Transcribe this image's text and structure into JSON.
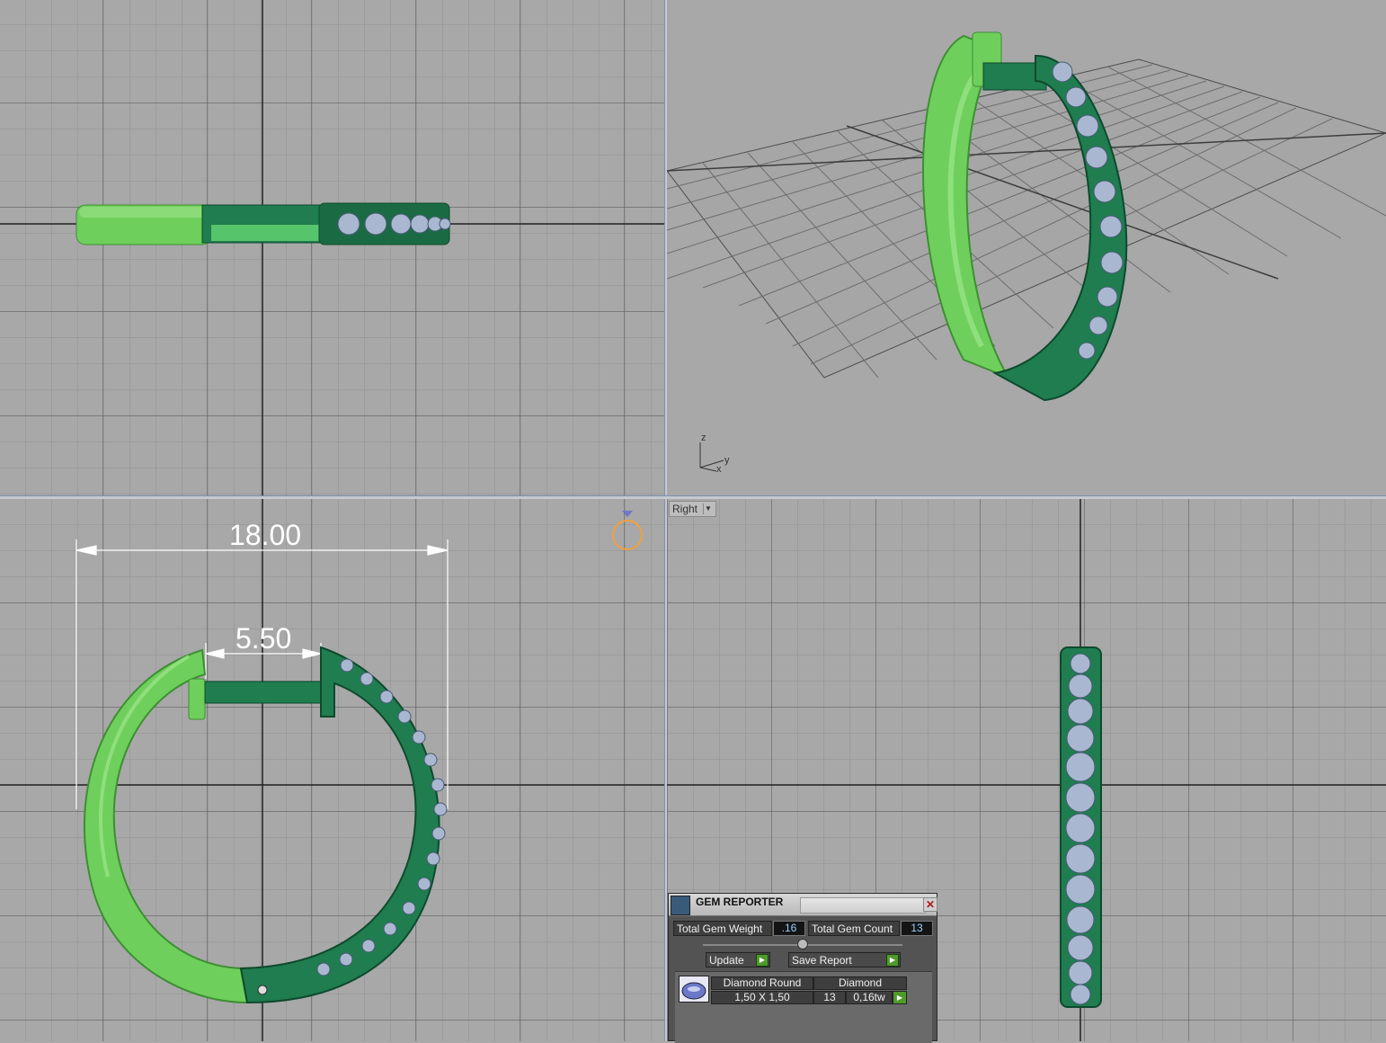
{
  "viewports": {
    "right_label": "Right",
    "front": {
      "dim_overall": "18.00",
      "dim_opening": "5.50"
    },
    "axis": {
      "z": "z",
      "y": "y",
      "x": "x"
    }
  },
  "gem_reporter": {
    "title": "GEM REPORTER",
    "total_weight_label": "Total Gem Weight",
    "total_weight_value": ".16",
    "total_count_label": "Total Gem Count",
    "total_count_value": "13",
    "update_label": "Update",
    "save_report_label": "Save Report",
    "rows": [
      {
        "shape": "Diamond Round",
        "material": "Diamond",
        "size": "1,50 X 1,50",
        "count": "13",
        "weight": "0,16tw"
      }
    ]
  },
  "colors": {
    "light_green": "#6fcf5c",
    "dark_green": "#1f7d4f",
    "gem": "#a9b7d1",
    "grid_bg": "#a8a8a8"
  }
}
